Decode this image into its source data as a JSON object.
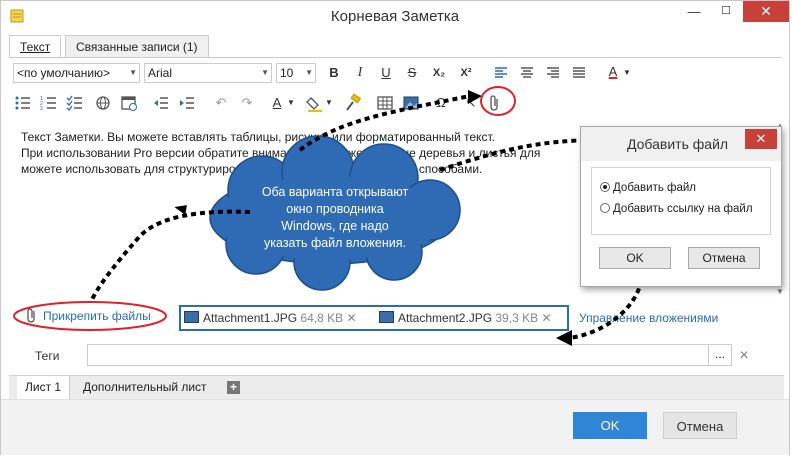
{
  "window": {
    "title": "Корневая Заметка",
    "min": "—",
    "max": "☐",
    "close": "✕"
  },
  "tabs": [
    {
      "label": "Текст"
    },
    {
      "label": "Связанные записи  (1)"
    }
  ],
  "toolbar": {
    "style_combo": "<по умолчанию>",
    "font_combo": "Arial",
    "size_combo": "10",
    "bold": "B",
    "italic": "I",
    "underline": "U",
    "strike": "S",
    "subscript": "X₂",
    "superscript": "X²",
    "font_color": "A"
  },
  "editor": {
    "lines": [
      "Текст Заметки. Вы можете вставлять таблицы, рисунки или форматированный текст.",
      "При использовании Pro версии обратите внимание на множественные деревья и листья для",
      "можете использовать для структурирования информации различными способами."
    ]
  },
  "attachments": {
    "attach_link": "Прикрепить файлы",
    "files": [
      {
        "name": "Attachment1.JPG",
        "size": "64,8 KB",
        "remove": "✕"
      },
      {
        "name": "Attachment2.JPG",
        "size": "39,3 KB",
        "remove": "✕"
      }
    ],
    "manage_link": "Управление вложениями"
  },
  "tags": {
    "label": "Теги",
    "value": "",
    "browse": "...",
    "clear": "✕"
  },
  "sheets": {
    "tabs": [
      "Лист 1",
      "Дополнительный лист"
    ],
    "add": "+"
  },
  "footer": {
    "ok": "OK",
    "cancel": "Отмена"
  },
  "dialog": {
    "title": "Добавить файл",
    "close": "✕",
    "options": [
      "Добавить файл",
      "Добавить ссылку на файл"
    ],
    "selected": 0,
    "ok": "OK",
    "cancel": "Отмена"
  },
  "callout": {
    "lines": [
      "Оба варианта открывают",
      "окно проводника",
      "Windows, где надо",
      "указать файл вложения."
    ],
    "cloud_color": "#2f6bb5"
  },
  "annotation_color": "#e0202a"
}
